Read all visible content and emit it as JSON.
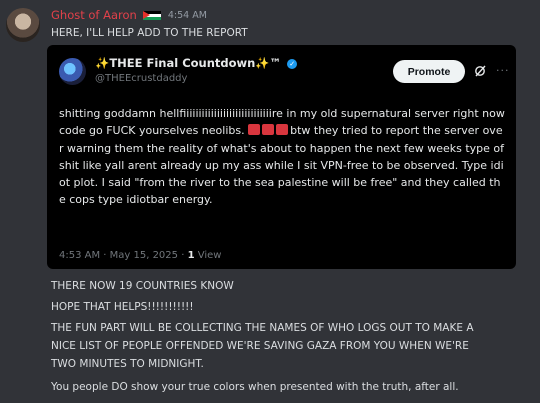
{
  "message": {
    "username": "Ghost of Aaron",
    "timestamp": "4:54 AM",
    "first_line": "HERE, I'LL HELP ADD TO THE REPORT",
    "lines": [
      "THERE NOW 19 COUNTRIES KNOW",
      "HOPE THAT HELPS!!!!!!!!!!!",
      "THE FUN PART WILL BE COLLECTING THE NAMES OF WHO LOGS OUT TO MAKE A",
      "NICE LIST OF PEOPLE OFFENDED WE'RE SAVING GAZA FROM YOU WHEN WE'RE",
      "TWO MINUTES TO MIDNIGHT.",
      "You people DO show your true colors when presented with the truth, after all."
    ]
  },
  "tweet": {
    "display_name": "✨THEE Final Countdown✨™",
    "handle": "@THEEcrustdaddy",
    "promote_label": "Promote",
    "text_part1": "shitting goddamn hellfiiiiiiiiiiiiiiiiiiiiiiiiiiiiire in my old supernatural server right now code go FUCK yourselves neolibs. ",
    "text_part2": "btw they tried to report the server over warning them the reality of what's about to happen the next few weeks type of shit like yall arent already up my ass while I sit VPN-free to be observed. Type idiot plot. I said \"from the river to the sea palestine will be free\" and they called the cops type idiotbar energy.",
    "time": "4:53 AM · May 15, 2025 · ",
    "views_count": "1",
    "views_label": " View"
  },
  "colors": {
    "username": "#e0414a",
    "background": "#313338",
    "embed_background": "#000000",
    "verified": "#1d9bf0"
  }
}
